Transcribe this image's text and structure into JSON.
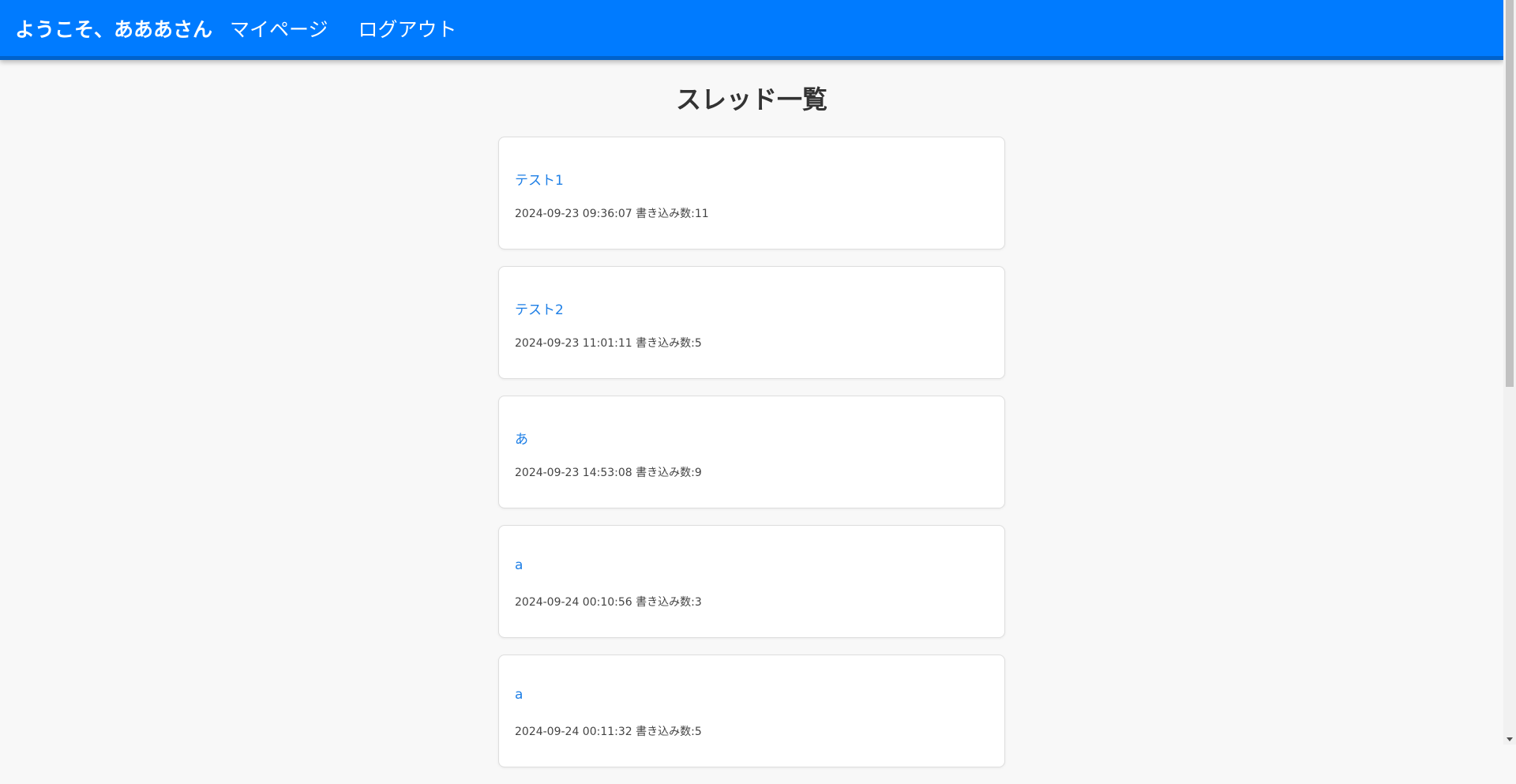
{
  "header": {
    "welcome": "ようこそ、あああさん",
    "mypage_label": "マイページ",
    "logout_label": "ログアウト"
  },
  "main": {
    "title": "スレッド一覧"
  },
  "threads": [
    {
      "title": "テスト1",
      "meta": "2024-09-23 09:36:07 書き込み数:11"
    },
    {
      "title": "テスト2",
      "meta": "2024-09-23 11:01:11 書き込み数:5"
    },
    {
      "title": "あ",
      "meta": "2024-09-23 14:53:08 書き込み数:9"
    },
    {
      "title": "a",
      "meta": "2024-09-24 00:10:56 書き込み数:3"
    },
    {
      "title": "a",
      "meta": "2024-09-24 00:11:32 書き込み数:5"
    }
  ],
  "colors": {
    "header_bg": "#007bff",
    "link": "#1e7fe6",
    "page_bg": "#f8f8f8"
  }
}
